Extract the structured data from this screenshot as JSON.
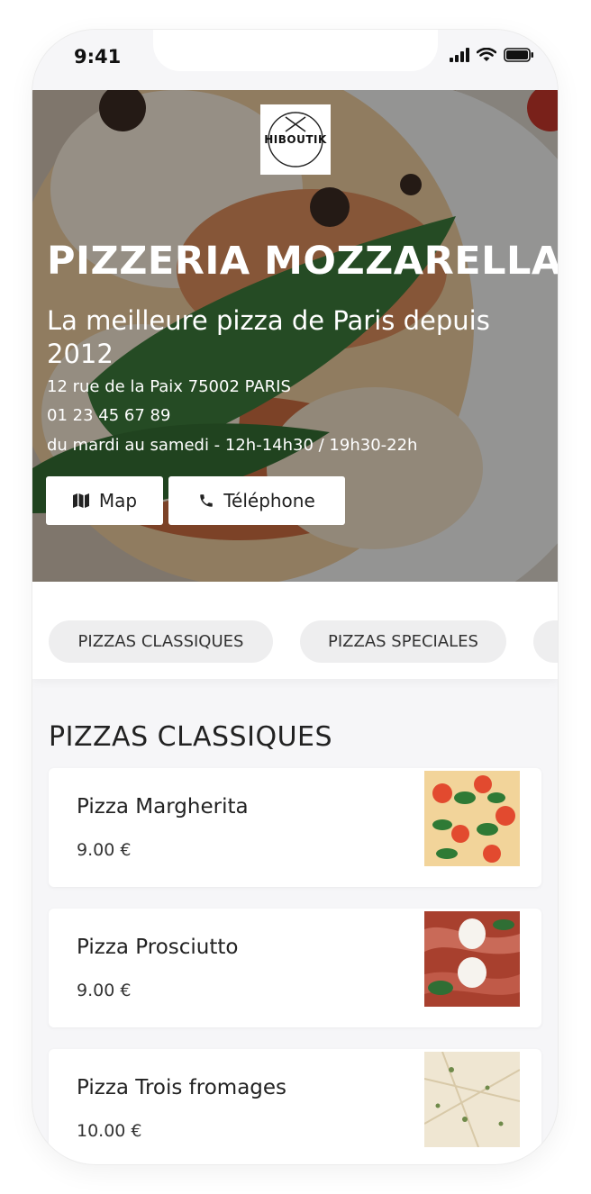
{
  "status_bar": {
    "time": "9:41"
  },
  "hero": {
    "logo_text": "HIBOUTIK",
    "title": "PIZZERIA MOZZARELLA",
    "subtitle": "La meilleure pizza de Paris depuis 2012",
    "address": "12 rue de la Paix 75002 PARIS",
    "phone": "01 23 45 67 89",
    "hours": "du mardi au samedi - 12h-14h30 / 19h30-22h",
    "map_button": "Map",
    "phone_button": "Téléphone"
  },
  "categories": [
    {
      "label": "PIZZAS CLASSIQUES"
    },
    {
      "label": "PIZZAS SPECIALES"
    }
  ],
  "section": {
    "title": "PIZZAS CLASSIQUES"
  },
  "items": [
    {
      "name": "Pizza Margherita",
      "price": "9.00 €"
    },
    {
      "name": "Pizza Prosciutto",
      "price": "9.00 €"
    },
    {
      "name": "Pizza Trois fromages",
      "price": "10.00 €"
    }
  ],
  "icons": {
    "map": "map-icon",
    "phone": "phone-icon",
    "signal": "signal-icon",
    "wifi": "wifi-icon",
    "battery": "battery-icon"
  }
}
